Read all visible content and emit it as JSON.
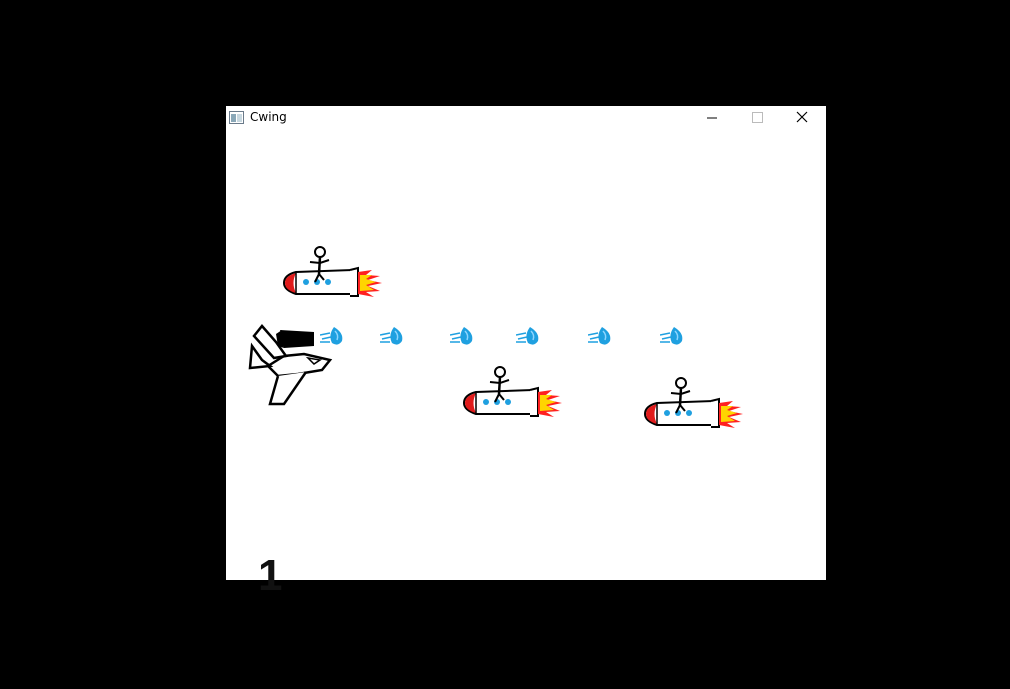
{
  "window": {
    "title": "Cwing",
    "controls": [
      "minimize-icon",
      "maximize-icon",
      "close-icon"
    ]
  },
  "game": {
    "score": "1",
    "player": {
      "sprite": "jet-plane-with-cannon"
    },
    "enemies": [
      {
        "sprite": "rocket-with-stick-rider"
      },
      {
        "sprite": "rocket-with-stick-rider"
      },
      {
        "sprite": "rocket-with-stick-rider"
      }
    ],
    "projectiles": [
      {
        "sprite": "blue-water-drop-bullet"
      },
      {
        "sprite": "blue-water-drop-bullet"
      },
      {
        "sprite": "blue-water-drop-bullet"
      },
      {
        "sprite": "blue-water-drop-bullet"
      },
      {
        "sprite": "blue-water-drop-bullet"
      },
      {
        "sprite": "blue-water-drop-bullet"
      }
    ],
    "colors": {
      "rocket_nose": "#e01b1b",
      "rocket_windows": "#1fa0e0",
      "flame_outer": "#ff2020",
      "flame_inner": "#ffd400",
      "bullet": "#1fa0e0",
      "ink": "#000000"
    }
  }
}
